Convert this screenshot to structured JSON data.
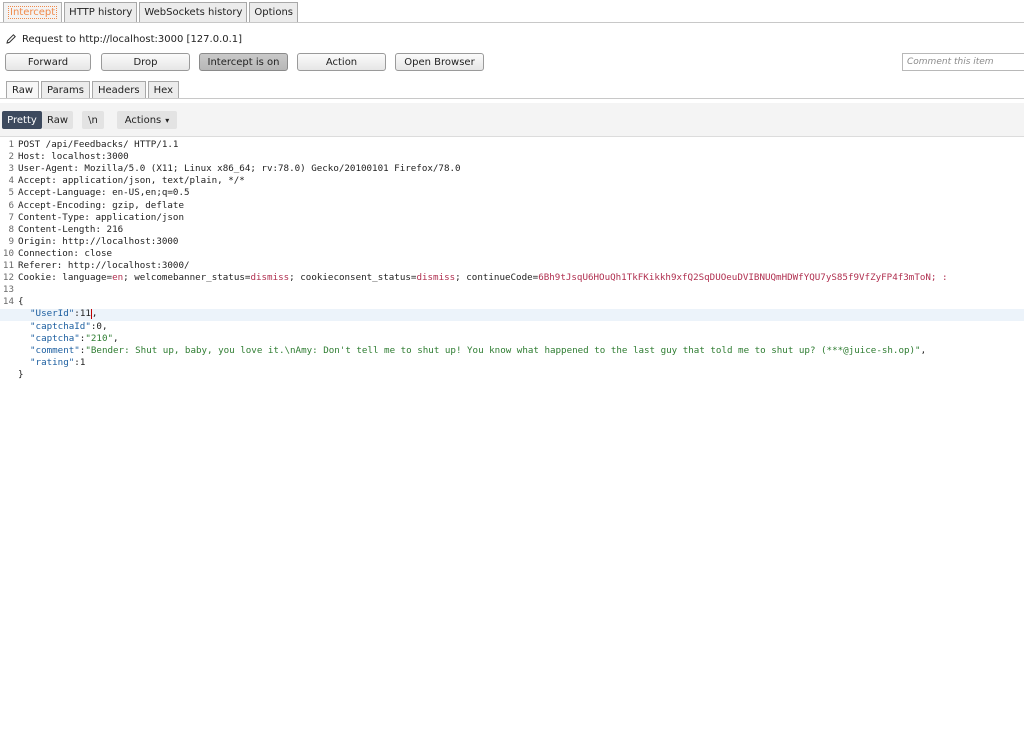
{
  "tabs": [
    "Intercept",
    "HTTP history",
    "WebSockets history",
    "Options"
  ],
  "request_line": "Request to http://localhost:3000  [127.0.0.1]",
  "buttons": {
    "forward": "Forward",
    "drop": "Drop",
    "intercept": "Intercept is on",
    "action": "Action",
    "open_browser": "Open Browser"
  },
  "comment_placeholder": "Comment this item",
  "subtabs": [
    "Raw",
    "Params",
    "Headers",
    "Hex"
  ],
  "view": {
    "pretty": "Pretty",
    "raw": "Raw",
    "newline": "\\n",
    "actions": "Actions"
  },
  "request": {
    "line1": "POST /api/Feedbacks/ HTTP/1.1",
    "headers": [
      {
        "n": "Host",
        "v": "localhost:3000"
      },
      {
        "n": "User-Agent",
        "v": "Mozilla/5.0 (X11; Linux x86_64; rv:78.0) Gecko/20100101 Firefox/78.0"
      },
      {
        "n": "Accept",
        "v": "application/json, text/plain, */*"
      },
      {
        "n": "Accept-Language",
        "v": "en-US,en;q=0.5"
      },
      {
        "n": "Accept-Encoding",
        "v": "gzip, deflate"
      },
      {
        "n": "Content-Type",
        "v": "application/json"
      },
      {
        "n": "Content-Length",
        "v": "216"
      },
      {
        "n": "Origin",
        "v": "http://localhost:3000"
      },
      {
        "n": "Connection",
        "v": "close"
      },
      {
        "n": "Referer",
        "v": "http://localhost:3000/"
      }
    ],
    "cookie_name": "Cookie",
    "cookies": [
      {
        "k": "language",
        "v": "en"
      },
      {
        "k": "welcomebanner_status",
        "v": "dismiss"
      },
      {
        "k": "cookieconsent_status",
        "v": "dismiss"
      },
      {
        "k": "continueCode",
        "v": "6Bh9tJsqU6HOuQh1TkFKikkh9xfQ2SqDUOeuDVIBNUQmHDWfYQU7yS85f9VfZyFP4f3mToN; :"
      }
    ],
    "body_open": "{",
    "body_close": "}",
    "body": [
      {
        "k": "\"UserId\"",
        "v": "11"
      },
      {
        "k": "\"captchaId\"",
        "v": "0"
      },
      {
        "k": "\"captcha\"",
        "v": "\"210\""
      },
      {
        "k": "\"comment\"",
        "v": "\"Bender: Shut up, baby, you love it.\\nAmy: Don't tell me to shut up! You know what happened to the last guy that told me to shut up? (***@juice-sh.op)\""
      },
      {
        "k": "\"rating\"",
        "v": "1"
      }
    ]
  }
}
